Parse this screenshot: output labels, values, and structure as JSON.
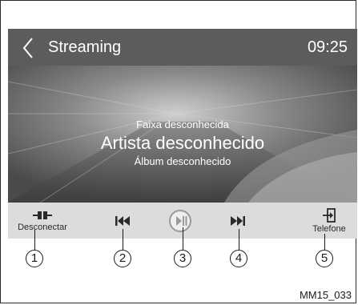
{
  "header": {
    "title": "Streaming",
    "clock": "09:25"
  },
  "track": {
    "title": "Faixa desconhecida",
    "artist": "Artista desconhecido",
    "album": "Álbum desconhecido"
  },
  "controls": {
    "disconnect_label": "Desconectar",
    "phone_label": "Telefone",
    "icons": [
      "disconnect-icon",
      "previous-track-icon",
      "play-pause-icon",
      "next-track-icon",
      "phone-icon"
    ]
  },
  "callouts": [
    "1",
    "2",
    "3",
    "4",
    "5"
  ],
  "reference_code": "MM15_033",
  "colors": {
    "header_bg": "#5c5c5c",
    "control_bar_bg": "#dcdcdc",
    "text_on_dark": "#ffffff"
  }
}
